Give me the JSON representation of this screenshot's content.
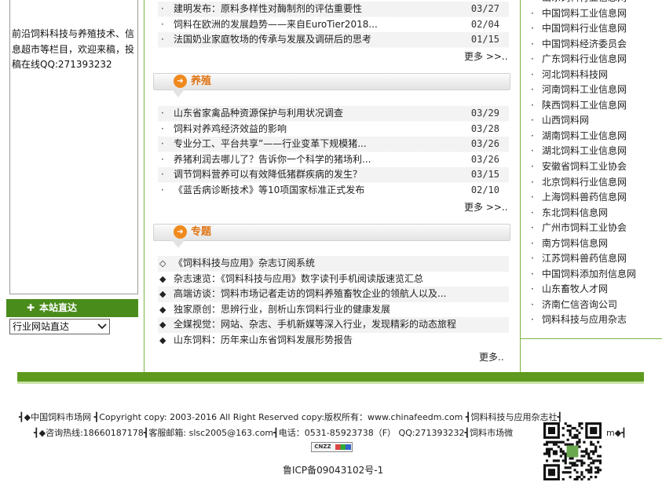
{
  "left": {
    "intro": "前沿饲料科技与养殖技术、信息超市等栏目，欢迎来稿，投稿在线QQ:271393232",
    "bar_label": "本站直达",
    "bar_icon": "plus-icon",
    "select_value": "行业网站直达"
  },
  "news_top": {
    "items": [
      {
        "title": "建明发布：原料多样性对酶制剂的评估重要性",
        "date": "03/27"
      },
      {
        "title": "饲料在欧洲的发展趋势——来自EuroTier2018...",
        "date": "02/04"
      },
      {
        "title": "法国奶业家庭牧场的传承与发展及调研后的思考",
        "date": "01/15"
      }
    ],
    "more": "更多 >>.."
  },
  "breeding": {
    "heading": "养殖",
    "items": [
      {
        "title": "山东省家禽品种资源保护与利用状况调查",
        "date": "03/29"
      },
      {
        "title": "饲料对养鸡经济效益的影响",
        "date": "03/28"
      },
      {
        "title": "专业分工、平台共享”——行业变革下规模猪...",
        "date": "03/26"
      },
      {
        "title": "养猪利润去哪儿了？告诉你一个科学的猪场利...",
        "date": "03/26"
      },
      {
        "title": "调节饲料营养可以有效降低猪群疾病的发生？",
        "date": "03/15"
      },
      {
        "title": "《蓝舌病诊断技术》等10项国家标准正式发布",
        "date": "02/10"
      }
    ],
    "more": "更多 >>.."
  },
  "topics": {
    "heading": "专题",
    "items": [
      {
        "marker": "◇",
        "title": "《饲料科技与应用》杂志订阅系统"
      },
      {
        "marker": "◆",
        "title": "杂志速览：《饲料科技与应用》数字读刊手机阅读版速览汇总"
      },
      {
        "marker": "◆",
        "title": "高端访谈：饲料市场记者走访的饲料养殖畜牧企业的领航人以及..."
      },
      {
        "marker": "◆",
        "title": "独家原创：思辨行业，剖析山东饲料行业的健康发展"
      },
      {
        "marker": "◆",
        "title": "全媒视觉：网站、杂志、手机新媒等深入行业，发现精彩的动态旅程"
      },
      {
        "marker": "◆",
        "title": "山东饲料：历年来山东省饲料发展形势报告"
      }
    ],
    "more": "更多.."
  },
  "links": [
    "山东饲料行业信息网",
    "中国饲料工业信息网",
    "中国饲料行业信息网",
    "中国饲料经济委员会",
    "广东饲料行业信息网",
    "河北饲料科技网",
    "河南饲料工业信息网",
    "陕西饲料工业信息网",
    "山西饲料网",
    "湖南饲料工业信息网",
    "湖北饲料工业信息网",
    "安徽省饲料工业协会",
    "北京饲料行业信息网",
    "上海饲料兽药信息网",
    "东北饲料信息网",
    "广州市饲料工业协会",
    "南方饲料信息网",
    "江苏饲料兽药信息网",
    "中国饲料添加剂信息网",
    "山东畜牧人才网",
    "济南仁信咨询公司",
    "饲料科技与应用杂志"
  ],
  "footer": {
    "line1": "┫◆中国饲料市场网 ┫Copyright copy: 2003-2016 All Right Reserved copy:版权所有：www.chinafeedm.com ┫饲料科技与应用杂志社┫",
    "line2": "┫◆咨询热线:18660187178┫客服邮箱: slsc2005@163.com┫电话：0531-85923738（F） QQ:271393232┫饲料市场微",
    "line2_tail": "m◆┫",
    "cnzz": "CNZZ",
    "icp": "鲁ICP备09043102号-1"
  },
  "colors": {
    "green": "#5e9a1e",
    "orange": "#f08a1e",
    "border_green": "#7bb342"
  }
}
